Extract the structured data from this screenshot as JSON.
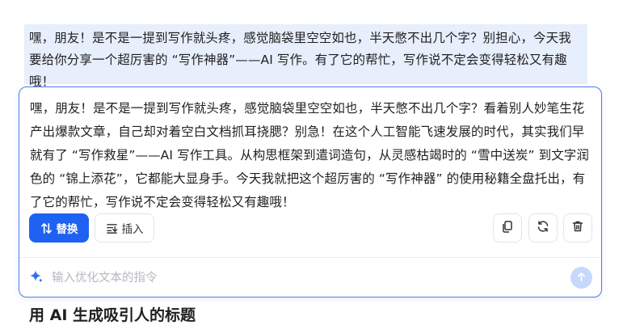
{
  "document": {
    "selected_paragraph": "嘿，朋友！是不是一提到写作就头疼，感觉脑袋里空空如也，半天憋不出几个字？别担心，今天我要给你分享一个超厉害的 “写作神器”——AI 写作。有了它的帮忙，写作说不定会变得轻松又有趣哦！",
    "next_heading": "用 AI 生成吸引人的标题"
  },
  "ai_panel": {
    "result_text": "嘿，朋友！是不是一提到写作就头疼，感觉脑袋里空空如也，半天憋不出几个字？看着别人妙笔生花产出爆款文章，自己却对着空白文档抓耳挠腮？别急！在这个人工智能飞速发展的时代，其实我们早就有了 “写作救星”——AI 写作工具。从构思框架到遣词造句，从灵感枯竭时的 “雪中送炭” 到文字润色的 “锦上添花”，它都能大显身手。今天我就把这个超厉害的 “写作神器” 的使用秘籍全盘托出，有了它的帮忙，写作说不定会变得轻松又有趣哦！",
    "replace_label": "替换",
    "insert_label": "插入",
    "prompt_placeholder": "输入优化文本的指令",
    "icons": {
      "replace": "swap-vertical-icon",
      "insert": "insert-lines-icon",
      "copy": "copy-icon",
      "regenerate": "refresh-icon",
      "delete": "trash-icon",
      "prompt": "sparkle-icon",
      "send": "send-arrow-icon"
    }
  },
  "colors": {
    "accent": "#1f62f2",
    "selection": "#e7eefc",
    "panel_border": "#4c7bf0",
    "send_disabled": "#c6d8fb"
  }
}
